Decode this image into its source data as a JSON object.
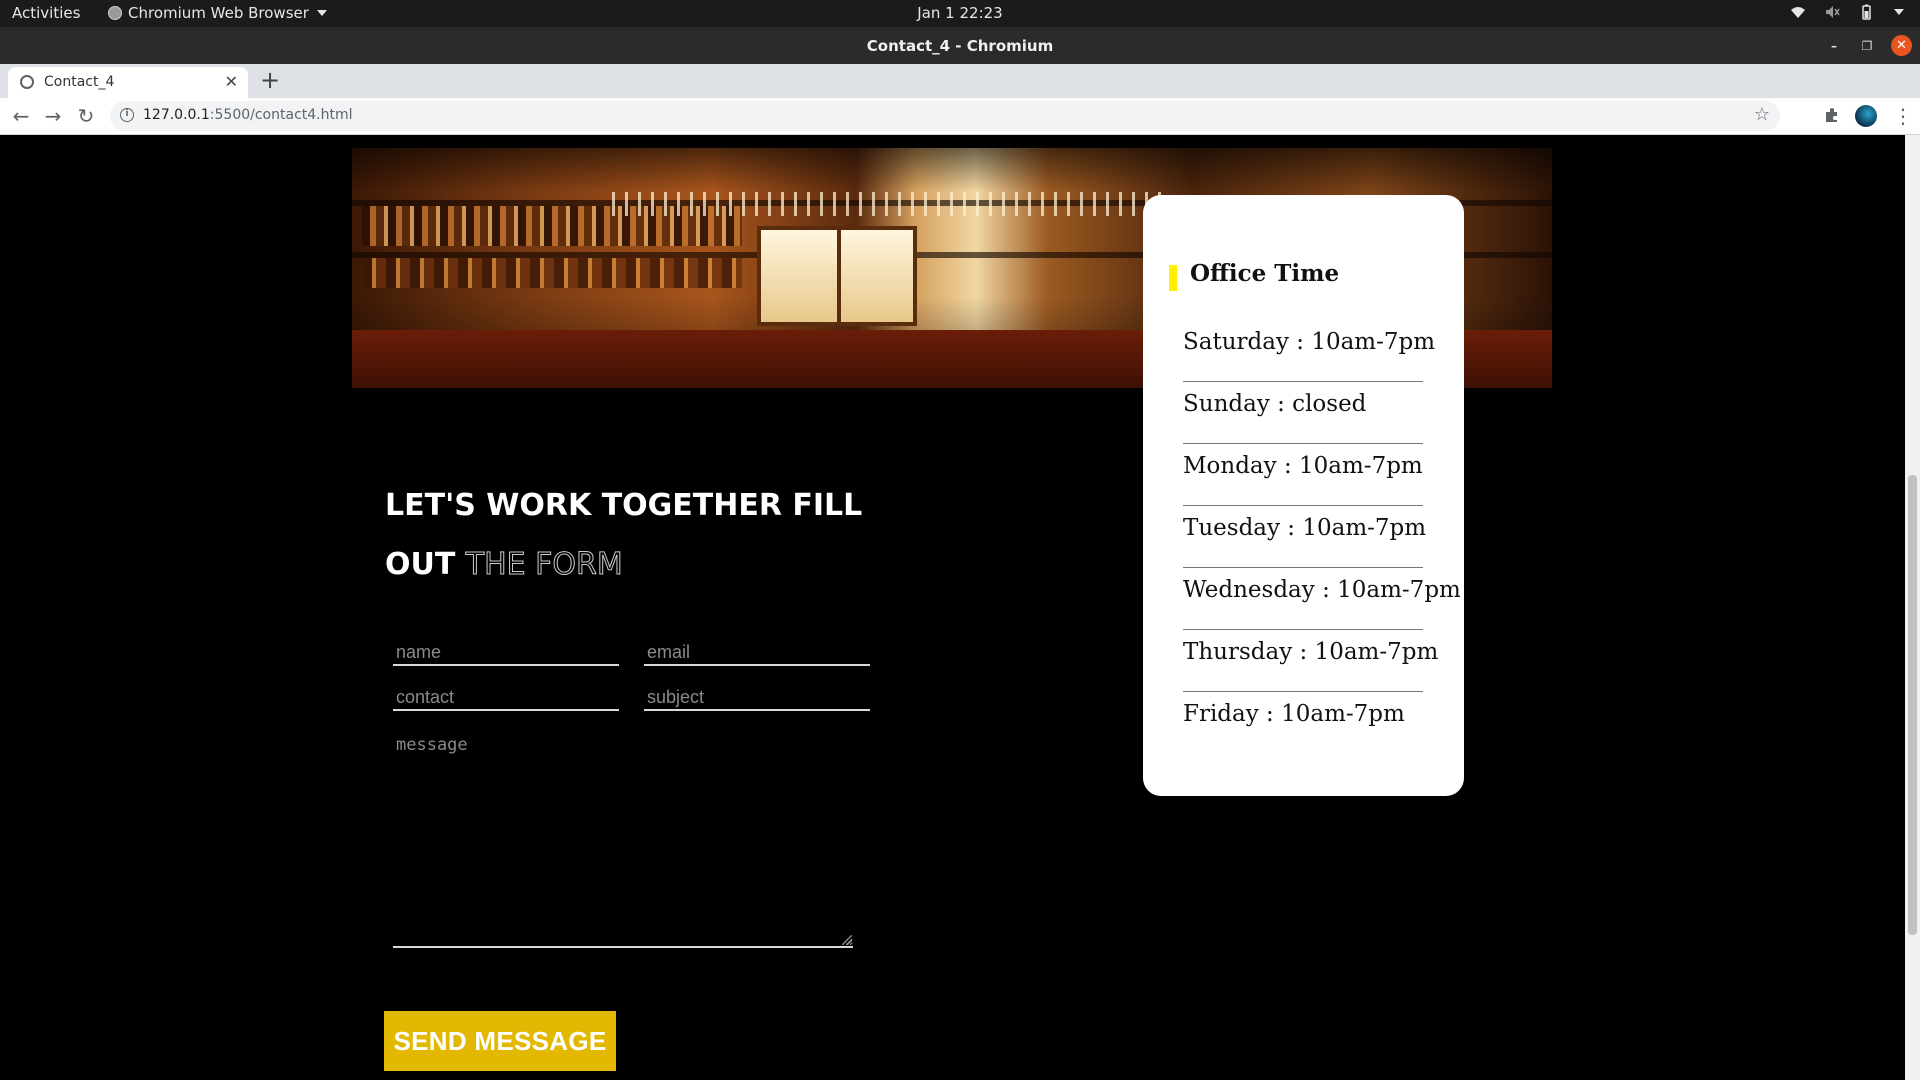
{
  "system_bar": {
    "activities": "Activities",
    "app_name": "Chromium Web Browser",
    "clock": "Jan 1  22:23"
  },
  "window": {
    "title": "Contact_4 - Chromium"
  },
  "browser": {
    "tab_title": "Contact_4",
    "url_host": "127.0.0.1",
    "url_rest": ":5500/contact4.html"
  },
  "heading": {
    "line1": "LET'S WORK TOGETHER FILL",
    "line2_solid": "OUT",
    "line2_outline": "THE FORM"
  },
  "form": {
    "name_placeholder": "name",
    "email_placeholder": "email",
    "contact_placeholder": "contact",
    "subject_placeholder": "subject",
    "message_placeholder": "message",
    "submit_label": "SEND MESSAGE"
  },
  "office": {
    "title": "Office Time",
    "hours": [
      "Saturday : 10am-7pm",
      "Sunday : closed",
      "Monday : 10am-7pm",
      "Tuesday : 10am-7pm",
      "Wednesday : 10am-7pm",
      "Thursday : 10am-7pm",
      "Friday : 10am-7pm"
    ]
  },
  "colors": {
    "accent_yellow": "#ffef00",
    "button_gold": "#e3b800",
    "page_background": "#000000"
  }
}
